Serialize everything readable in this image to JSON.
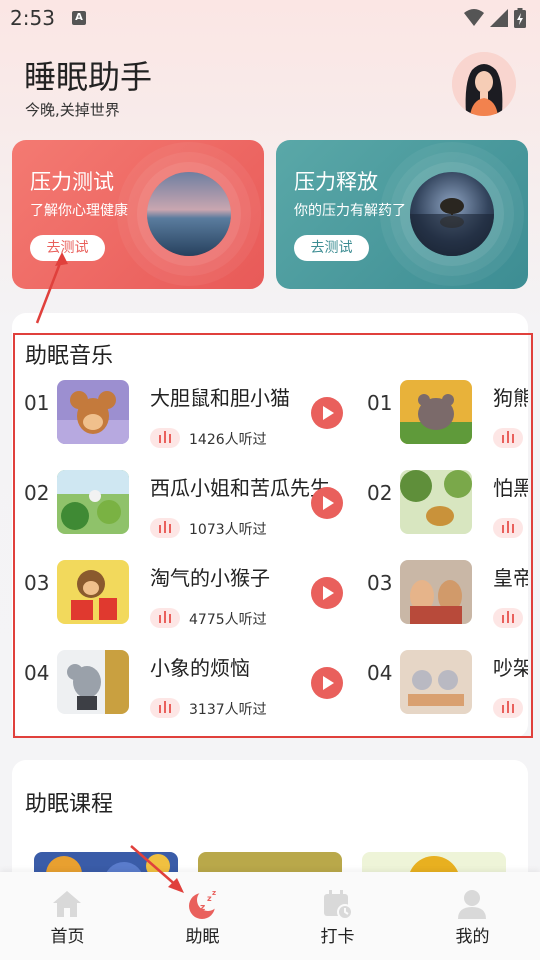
{
  "status_bar": {
    "time": "2:53",
    "notification_badge": "A"
  },
  "header": {
    "title": "睡眠助手",
    "subtitle": "今晚,关掉世界"
  },
  "cards": [
    {
      "title": "压力测试",
      "desc": "了解你心理健康",
      "button": "去测试"
    },
    {
      "title": "压力释放",
      "desc": "你的压力有解药了",
      "button": "去测试"
    }
  ],
  "music": {
    "title": "助眠音乐",
    "left": [
      {
        "num": "01",
        "title": "大胆鼠和胆小猫",
        "count": "1426人听过"
      },
      {
        "num": "02",
        "title": "西瓜小姐和苦瓜先生",
        "count": "1073人听过"
      },
      {
        "num": "03",
        "title": "淘气的小猴子",
        "count": "4775人听过"
      },
      {
        "num": "04",
        "title": "小象的烦恼",
        "count": "3137人听过"
      }
    ],
    "right": [
      {
        "num": "01",
        "title": "狗熊"
      },
      {
        "num": "02",
        "title": "怕黑"
      },
      {
        "num": "03",
        "title": "皇帝"
      },
      {
        "num": "04",
        "title": "吵架"
      }
    ]
  },
  "courses": {
    "title": "助眠课程"
  },
  "nav": [
    {
      "label": "首页",
      "icon": "home-icon"
    },
    {
      "label": "助眠",
      "icon": "sleep-icon",
      "active": true
    },
    {
      "label": "打卡",
      "icon": "calendar-check-icon"
    },
    {
      "label": "我的",
      "icon": "user-icon"
    }
  ],
  "colors": {
    "accent": "#e9605c",
    "teal": "#3d8d93",
    "highlight": "#e0403c"
  }
}
